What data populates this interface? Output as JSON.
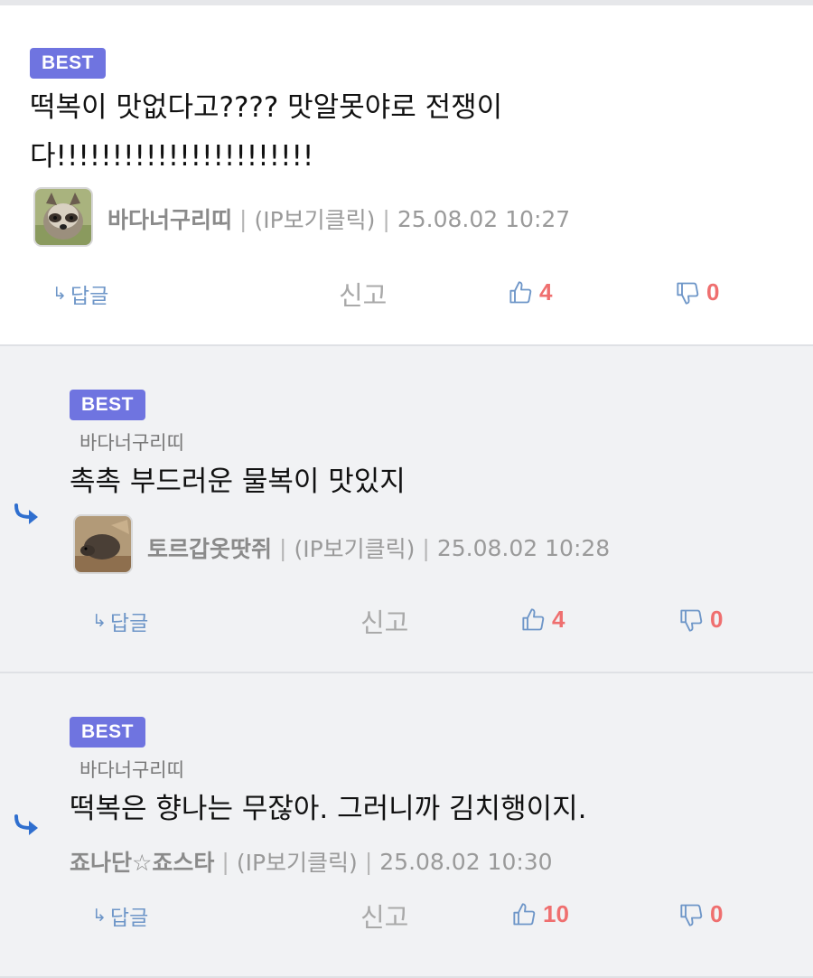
{
  "comments": [
    {
      "badge": "BEST",
      "mention": "",
      "text_line1": "떡복이 맛없다고???? 맛알못야로 전쟁이",
      "text_line2": "다!!!!!!!!!!!!!!!!!!!!!!!",
      "nickname": "바다너구리띠",
      "ip_label": "(IP보기클릭)",
      "timestamp": "25.08.02 10:27",
      "reply_label": "답글",
      "report_label": "신고",
      "likes": "4",
      "dislikes": "0"
    },
    {
      "badge": "BEST",
      "mention": "바다너구리띠",
      "text": "촉촉 부드러운 물복이 맛있지",
      "nickname": "토르갑옷땃쥐",
      "ip_label": "(IP보기클릭)",
      "timestamp": "25.08.02 10:28",
      "reply_label": "답글",
      "report_label": "신고",
      "likes": "4",
      "dislikes": "0"
    },
    {
      "badge": "BEST",
      "mention": "바다너구리띠",
      "text": "떡복은 향나는 무잖아. 그러니까 김치행이지.",
      "nickname": "죠나단☆죠스타",
      "ip_label": "(IP보기클릭)",
      "timestamp": "25.08.02 10:30",
      "reply_label": "답글",
      "report_label": "신고",
      "likes": "10",
      "dislikes": "0"
    }
  ],
  "separator": "|",
  "colors": {
    "badge": "#6f74e0",
    "vote_count": "#ef6f6f",
    "reply_link": "#6e96c8",
    "reply_indicator": "#2f6fcf"
  }
}
